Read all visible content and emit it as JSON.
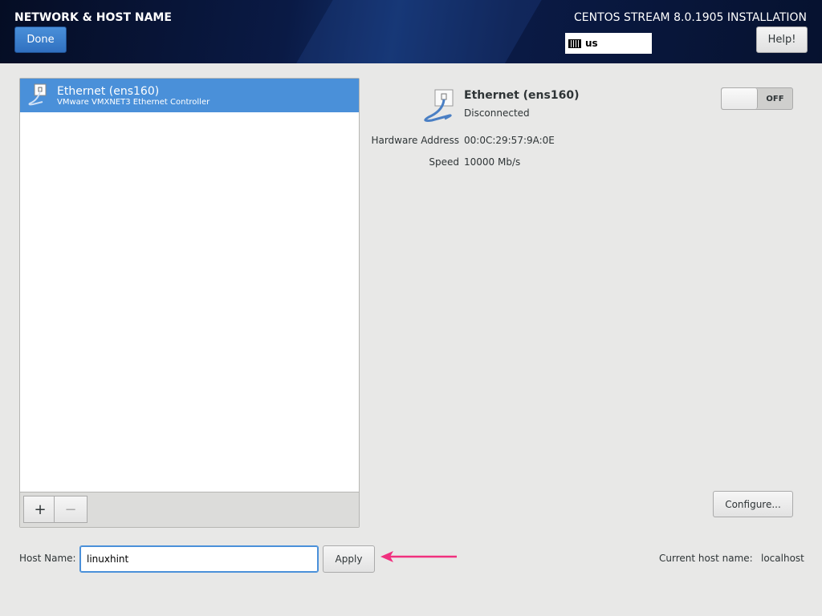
{
  "header": {
    "title": "NETWORK & HOST NAME",
    "product": "CENTOS STREAM 8.0.1905 INSTALLATION",
    "done_label": "Done",
    "help_label": "Help!",
    "keyboard_layout": "us"
  },
  "devices": [
    {
      "name": "Ethernet (ens160)",
      "description": "VMware VMXNET3 Ethernet Controller"
    }
  ],
  "list_toolbar": {
    "add_label": "+",
    "remove_label": "−"
  },
  "detail": {
    "name": "Ethernet (ens160)",
    "status": "Disconnected",
    "hw_label": "Hardware Address",
    "hw_value": "00:0C:29:57:9A:0E",
    "speed_label": "Speed",
    "speed_value": "10000 Mb/s",
    "toggle_label": "OFF",
    "configure_label": "Configure..."
  },
  "hostname": {
    "label": "Host Name:",
    "value": "linuxhint",
    "apply_label": "Apply",
    "current_label": "Current host name:",
    "current_value": "localhost"
  },
  "colors": {
    "accent": "#4a90d9",
    "arrow": "#f0307f"
  }
}
